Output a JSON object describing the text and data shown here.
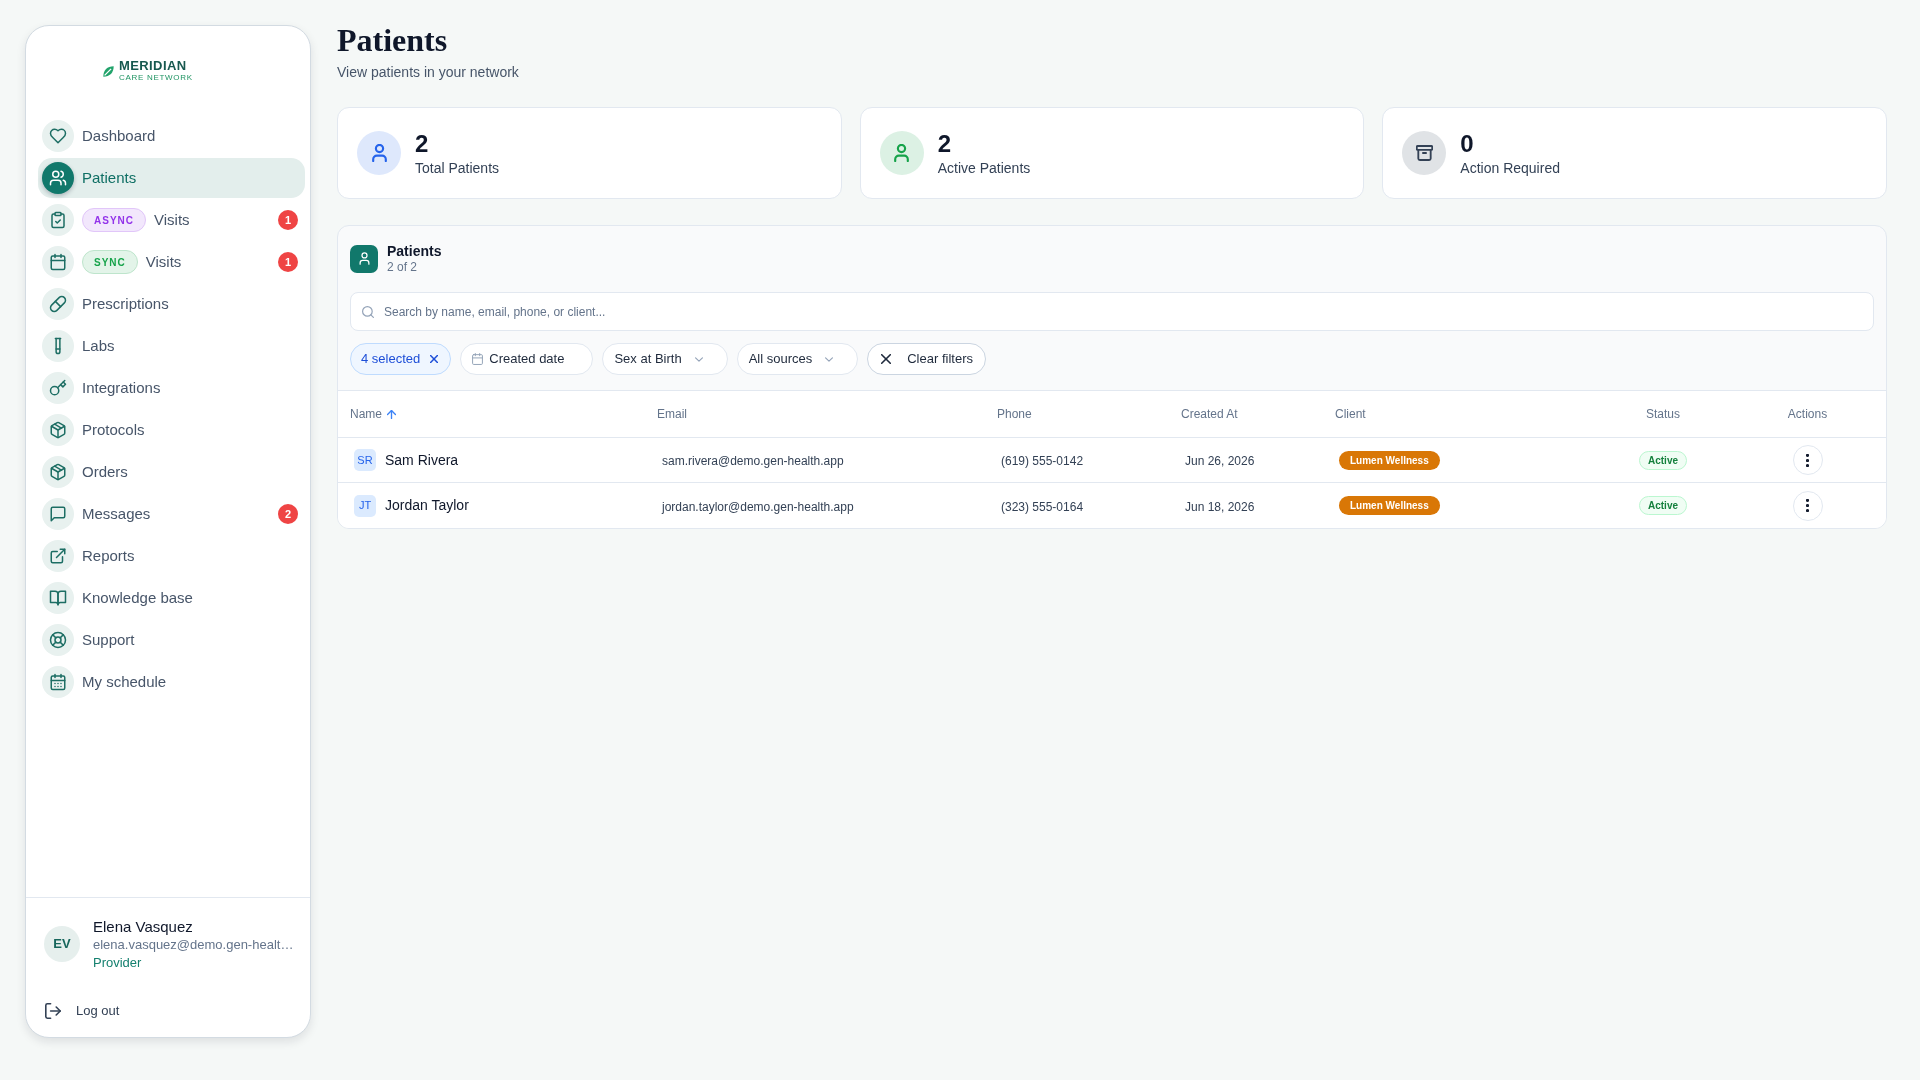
{
  "sidebar": {
    "logo": {
      "wordmark": "MERIDIAN",
      "tagline": "CARE NETWORK"
    },
    "nav_items": [
      {
        "label": "Dashboard",
        "selected": false
      },
      {
        "label": "Patients",
        "selected": true
      },
      {
        "label": "Visits",
        "selected": false,
        "tag": {
          "text": "ASYNC",
          "color": "#9333ea"
        },
        "count": "1"
      },
      {
        "label": "Visits",
        "selected": false,
        "tag": {
          "text": "SYNC",
          "color": "#16a34a"
        },
        "count": "1"
      },
      {
        "label": "Prescriptions",
        "selected": false
      },
      {
        "label": "Labs",
        "selected": false
      },
      {
        "label": "Integrations",
        "selected": false
      },
      {
        "label": "Protocols",
        "selected": false
      },
      {
        "label": "Orders",
        "selected": false
      },
      {
        "label": "Messages",
        "selected": false,
        "count": "2"
      },
      {
        "label": "Reports",
        "selected": false
      },
      {
        "label": "Knowledge base",
        "selected": false
      },
      {
        "label": "Support",
        "selected": false
      },
      {
        "label": "My schedule",
        "selected": false
      }
    ],
    "user": {
      "initials": "EV",
      "name": "Elena Vasquez",
      "email": "elena.vasquez@demo.gen-healt…",
      "role": "Provider"
    },
    "logout": "Log out"
  },
  "header": {
    "title": "Patients",
    "subtitle": "View patients in your network"
  },
  "stats": [
    {
      "value": "2",
      "label": "Total Patients",
      "color": "#2563eb"
    },
    {
      "value": "2",
      "label": "Active Patients",
      "color": "#16a34a"
    },
    {
      "value": "0",
      "label": "Action Required",
      "color": "#334155"
    }
  ],
  "patients_panel": {
    "title": "Patients",
    "count": "2 of 2",
    "search": {
      "placeholder": "Search by name, email, phone, or client..."
    },
    "filters": [
      {
        "kind": "selection",
        "label": "4 selected"
      },
      {
        "kind": "date",
        "label": "Created date"
      },
      {
        "kind": "select",
        "label": "Sex at Birth"
      },
      {
        "kind": "select",
        "label": "All sources"
      },
      {
        "kind": "clear",
        "label": "Clear filters"
      }
    ],
    "table": {
      "columns": [
        {
          "label": "Name",
          "sorted": true
        },
        {
          "label": "Email",
          "sorted": false
        },
        {
          "label": "Phone",
          "sorted": false
        },
        {
          "label": "Created At",
          "sorted": false
        },
        {
          "label": "Client",
          "sorted": false
        },
        {
          "label": "Status",
          "sorted": false
        },
        {
          "label": "Actions",
          "sorted": false
        }
      ],
      "rows": [
        {
          "initials": "SR",
          "name": "Sam Rivera",
          "email": "sam.rivera@demo.gen-health.app",
          "phone": "(619) 555-0142",
          "created_at": "Jun 26, 2026",
          "client": "Lumen Wellness",
          "status": "Active"
        },
        {
          "initials": "JT",
          "name": "Jordan Taylor",
          "email": "jordan.taylor@demo.gen-health.app",
          "phone": "(323) 555-0164",
          "created_at": "Jun 18, 2026",
          "client": "Lumen Wellness",
          "status": "Active"
        }
      ]
    }
  }
}
